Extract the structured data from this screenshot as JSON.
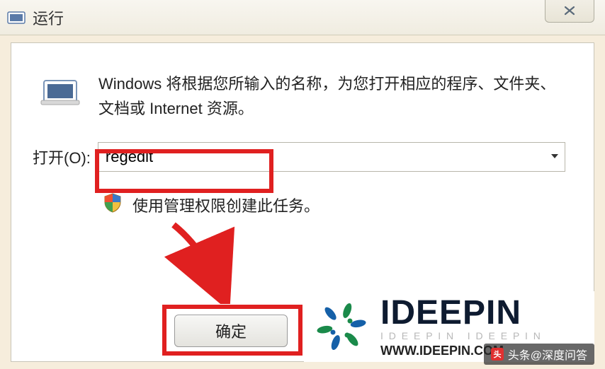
{
  "titlebar": {
    "title": "运行"
  },
  "dialog": {
    "description": "Windows 将根据您所输入的名称，为您打开相应的程序、文件夹、文档或 Internet 资源。",
    "open_label": "打开(O):",
    "input_value": "regedit",
    "admin_note": "使用管理权限创建此任务。",
    "ok_label": "确定"
  },
  "watermark": {
    "brand": "IDEEPIN",
    "url": "WWW.IDEEPIN.COM",
    "source": "头条@深度问答"
  }
}
